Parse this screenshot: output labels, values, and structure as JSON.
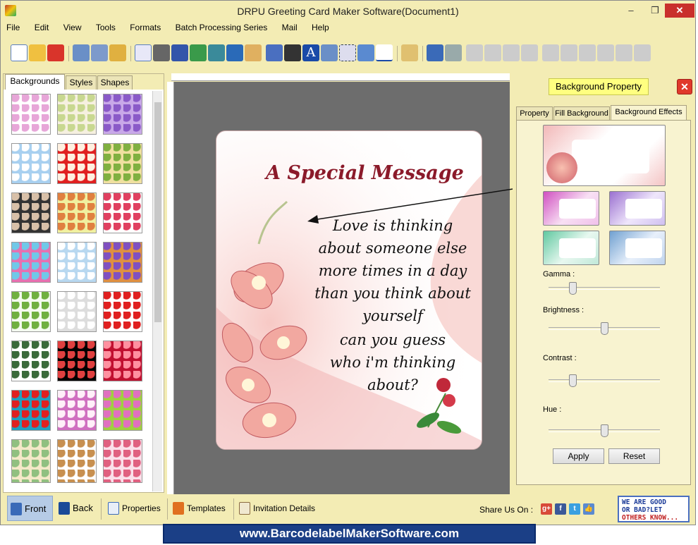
{
  "window": {
    "title": "DRPU Greeting Card Maker Software(Document1)",
    "minimize": "–",
    "restore": "❐",
    "close": "✕"
  },
  "menu": [
    "File",
    "Edit",
    "View",
    "Tools",
    "Formats",
    "Batch Processing Series",
    "Mail",
    "Help"
  ],
  "left_panel": {
    "tabs": [
      "Backgrounds",
      "Styles",
      "Shapes"
    ],
    "active_tab": "Backgrounds"
  },
  "card": {
    "title": "A Special Message",
    "lines": [
      "Love is thinking",
      "about someone else",
      "more times in a day",
      "than you think about",
      "yourself",
      "can you guess",
      "who i'm thinking",
      "about?"
    ]
  },
  "right_panel": {
    "header": "Background Property",
    "tabs": [
      "Property",
      "Fill Background",
      "Background Effects"
    ],
    "active_tab": "Background Effects",
    "sliders": [
      {
        "label": "Gamma :",
        "value": 0.2
      },
      {
        "label": "Brightness :",
        "value": 0.5
      },
      {
        "label": "Contrast :",
        "value": 0.2
      },
      {
        "label": "Hue :",
        "value": 0.5
      }
    ],
    "apply": "Apply",
    "reset": "Reset"
  },
  "bottom_bar": {
    "front": "Front",
    "back": "Back",
    "properties": "Properties",
    "templates": "Templates",
    "invitation": "Invitation Details",
    "share": "Share Us On :"
  },
  "feedback": {
    "line1": "WE ARE GOOD",
    "line2": "OR BAD?LET",
    "line3": "OTHERS KNOW..."
  },
  "footer": "www.BarcodelabelMakerSoftware.com",
  "colors": {
    "accent": "#f3ecb4",
    "card_title": "#8b1a2a",
    "footer": "#1b3f86"
  }
}
